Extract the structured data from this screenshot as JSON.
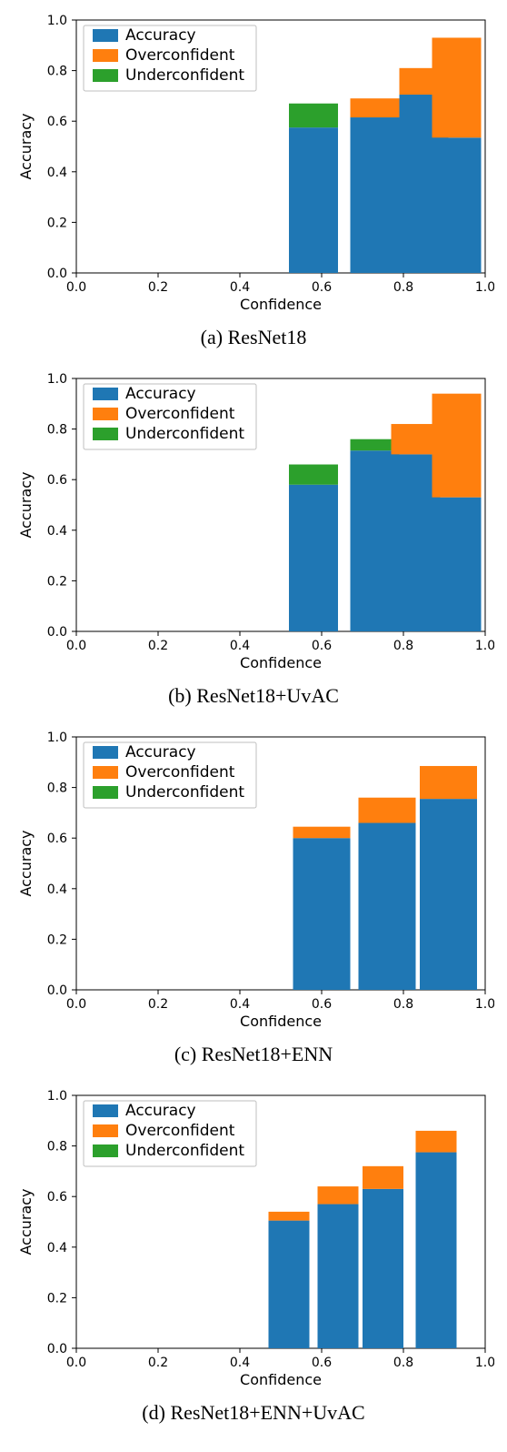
{
  "chart_data": [
    {
      "caption": "(a) ResNet18",
      "type": "bar",
      "xlabel": "Confidence",
      "ylabel": "Accuracy",
      "xlim": [
        0.0,
        1.0
      ],
      "ylim": [
        0.0,
        1.0
      ],
      "xticks": [
        0.0,
        0.2,
        0.4,
        0.6,
        0.8,
        1.0
      ],
      "yticks": [
        0.0,
        0.2,
        0.4,
        0.6,
        0.8,
        1.0
      ],
      "legend": [
        "Accuracy",
        "Overconfident",
        "Underconfident"
      ],
      "bar_centers": [
        0.58,
        0.73,
        0.85,
        0.93
      ],
      "bar_width": 0.12,
      "series": [
        {
          "name": "Accuracy",
          "values": [
            0.575,
            0.615,
            0.705,
            0.535
          ]
        },
        {
          "name": "Overconfident",
          "values": [
            0.0,
            0.075,
            0.105,
            0.395
          ]
        },
        {
          "name": "Underconfident",
          "values": [
            0.095,
            0.0,
            0.0,
            0.0
          ]
        }
      ]
    },
    {
      "caption": "(b) ResNet18+UvAC",
      "type": "bar",
      "xlabel": "Confidence",
      "ylabel": "Accuracy",
      "xlim": [
        0.0,
        1.0
      ],
      "ylim": [
        0.0,
        1.0
      ],
      "xticks": [
        0.0,
        0.2,
        0.4,
        0.6,
        0.8,
        1.0
      ],
      "yticks": [
        0.0,
        0.2,
        0.4,
        0.6,
        0.8,
        1.0
      ],
      "legend": [
        "Accuracy",
        "Overconfident",
        "Underconfident"
      ],
      "bar_centers": [
        0.58,
        0.73,
        0.83,
        0.93
      ],
      "bar_width": 0.12,
      "series": [
        {
          "name": "Accuracy",
          "values": [
            0.58,
            0.715,
            0.7,
            0.53
          ]
        },
        {
          "name": "Overconfident",
          "values": [
            0.0,
            0.0,
            0.12,
            0.41
          ]
        },
        {
          "name": "Underconfident",
          "values": [
            0.08,
            0.045,
            0.0,
            0.0
          ]
        }
      ]
    },
    {
      "caption": "(c) ResNet18+ENN",
      "type": "bar",
      "xlabel": "Confidence",
      "ylabel": "Accuracy",
      "xlim": [
        0.0,
        1.0
      ],
      "ylim": [
        0.0,
        1.0
      ],
      "xticks": [
        0.0,
        0.2,
        0.4,
        0.6,
        0.8,
        1.0
      ],
      "yticks": [
        0.0,
        0.2,
        0.4,
        0.6,
        0.8,
        1.0
      ],
      "legend": [
        "Accuracy",
        "Overconfident",
        "Underconfident"
      ],
      "bar_centers": [
        0.6,
        0.76,
        0.91
      ],
      "bar_width": 0.14,
      "series": [
        {
          "name": "Accuracy",
          "values": [
            0.6,
            0.66,
            0.755
          ]
        },
        {
          "name": "Overconfident",
          "values": [
            0.045,
            0.1,
            0.13
          ]
        },
        {
          "name": "Underconfident",
          "values": [
            0.0,
            0.0,
            0.0
          ]
        }
      ]
    },
    {
      "caption": "(d) ResNet18+ENN+UvAC",
      "type": "bar",
      "xlabel": "Confidence",
      "ylabel": "Accuracy",
      "xlim": [
        0.0,
        1.0
      ],
      "ylim": [
        0.0,
        1.0
      ],
      "xticks": [
        0.0,
        0.2,
        0.4,
        0.6,
        0.8,
        1.0
      ],
      "yticks": [
        0.0,
        0.2,
        0.4,
        0.6,
        0.8,
        1.0
      ],
      "legend": [
        "Accuracy",
        "Overconfident",
        "Underconfident"
      ],
      "bar_centers": [
        0.52,
        0.64,
        0.75,
        0.88
      ],
      "bar_width": 0.1,
      "series": [
        {
          "name": "Accuracy",
          "values": [
            0.505,
            0.57,
            0.63,
            0.775
          ]
        },
        {
          "name": "Overconfident",
          "values": [
            0.035,
            0.07,
            0.09,
            0.085
          ]
        },
        {
          "name": "Underconfident",
          "values": [
            0.0,
            0.0,
            0.0,
            0.0
          ]
        }
      ]
    }
  ]
}
